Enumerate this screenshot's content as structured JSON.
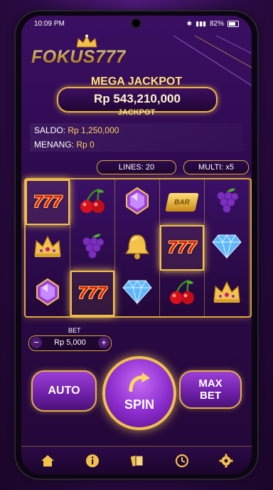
{
  "status": {
    "time": "10:09 PM",
    "battery": "82%"
  },
  "brand": {
    "name": "FOKUS777"
  },
  "jackpot": {
    "title": "MEGA JACKPOT",
    "value": "Rp 543,210,000",
    "label": "JACKPOT"
  },
  "balance": {
    "saldo_label": "SALDO:",
    "saldo_value": "Rp 1,250,000",
    "menang_label": "MENANG:",
    "menang_value": "Rp 0"
  },
  "settings": {
    "lines": "LINES: 20",
    "multi": "MULTI: x5"
  },
  "reels": [
    [
      {
        "symbol": "seven-icon",
        "text": "777",
        "highlight": true
      },
      {
        "symbol": "crown-icon",
        "highlight": false
      },
      {
        "symbol": "purple-gem-icon",
        "highlight": false
      }
    ],
    [
      {
        "symbol": "cherries-icon",
        "highlight": false
      },
      {
        "symbol": "grapes-icon",
        "highlight": false
      },
      {
        "symbol": "seven-icon",
        "text": "777",
        "highlight": true
      }
    ],
    [
      {
        "symbol": "purple-gem-icon",
        "highlight": false
      },
      {
        "symbol": "bell-icon",
        "highlight": false
      },
      {
        "symbol": "diamond-icon",
        "highlight": false
      }
    ],
    [
      {
        "symbol": "gold-bar-icon",
        "text": "BAR",
        "highlight": false
      },
      {
        "symbol": "seven-icon",
        "text": "777",
        "highlight": true
      },
      {
        "symbol": "cherries-icon",
        "highlight": false
      }
    ],
    [
      {
        "symbol": "grapes-icon",
        "highlight": false
      },
      {
        "symbol": "diamond-icon",
        "highlight": false
      },
      {
        "symbol": "crown-icon",
        "highlight": false
      }
    ]
  ],
  "bet": {
    "label": "BET",
    "value": "Rp 5,000",
    "minus": "−",
    "plus": "+"
  },
  "controls": {
    "auto": "AUTO",
    "spin": "SPIN",
    "max_bet": "MAX BET"
  },
  "nav": [
    "home-icon",
    "info-icon",
    "paytable-icon",
    "history-icon",
    "settings-icon"
  ],
  "colors": {
    "gold": "#e2b145",
    "purple": "#8a2ccc",
    "jackpot_text": "#ffe27a"
  }
}
